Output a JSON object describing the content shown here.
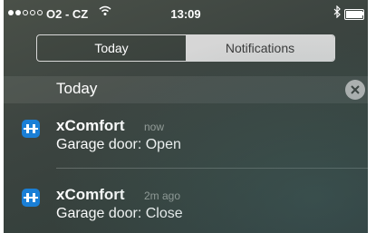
{
  "status_bar": {
    "signal": {
      "full": 2,
      "total": 5
    },
    "carrier": "O2 - CZ",
    "wifi_icon": "wifi-icon",
    "time": "13:09",
    "bluetooth_icon": "bluetooth-icon",
    "battery_icon": "battery-icon"
  },
  "segmented": {
    "items": [
      {
        "label": "Today",
        "selected": false
      },
      {
        "label": "Notifications",
        "selected": true
      }
    ]
  },
  "section": {
    "title": "Today",
    "clear_icon": "close-circle-icon"
  },
  "notifications": [
    {
      "app": "xComfort",
      "time": "now",
      "message": "Garage door: Open",
      "icon": "xcomfort-app-icon",
      "icon_color": "#1a7fd6"
    },
    {
      "app": "xComfort",
      "time": "2m ago",
      "message": "Garage door: Close",
      "icon": "xcomfort-app-icon",
      "icon_color": "#1a7fd6"
    }
  ]
}
